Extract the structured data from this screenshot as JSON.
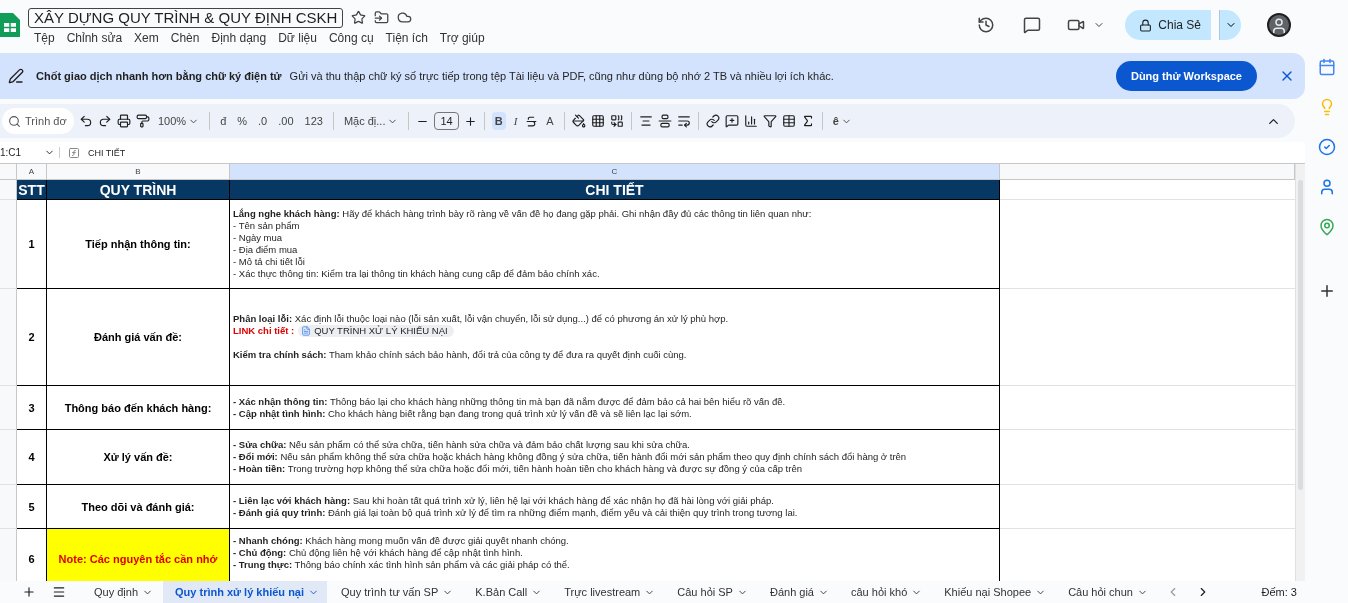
{
  "document": {
    "title": "XÂY DỰNG QUY TRÌNH & QUY ĐỊNH CSKH"
  },
  "menu": [
    "Tệp",
    "Chỉnh sửa",
    "Xem",
    "Chèn",
    "Định dạng",
    "Dữ liệu",
    "Công cụ",
    "Tiện ích",
    "Trợ giúp"
  ],
  "share_button": "Chia Sẻ",
  "banner": {
    "headline": "Chốt giao dịch nhanh hơn bằng chữ ký điện tử",
    "text": "Gửi và thu thập chữ ký số trực tiếp trong tệp Tài liệu và PDF, cũng như dùng bộ nhớ 2 TB và nhiều lợi ích khác.",
    "button": "Dùng thử Workspace"
  },
  "toolbar": {
    "search_placeholder": "Trình đơ",
    "zoom": "100%",
    "currency": "đ",
    "percent": "%",
    "decimal_decrease": ".0",
    "decimal_increase": ".00",
    "number_format": "123",
    "font": "Mặc đị...",
    "font_size": "14",
    "bold": {
      "label": "B",
      "selected": true
    },
    "italic": {
      "label": "I",
      "selected": false
    },
    "text_color": "A",
    "input_tools": "ê"
  },
  "formula_bar": {
    "name_box": "1:C1",
    "formula": "CHI TIẾT"
  },
  "columns": [
    "A",
    "B",
    "C"
  ],
  "header_row": [
    "STT",
    "QUY TRÌNH",
    "CHI TIẾT"
  ],
  "rows": [
    {
      "stt": "1",
      "step": "Tiếp nhận thông tin:",
      "highlight": false,
      "details": [
        {
          "kind": "text",
          "text": "**Lắng nghe khách hàng:** Hãy để khách hàng trình bày rõ ràng về vấn đề họ đang gặp phải. Ghi nhận đầy đủ các thông tin liên quan như:"
        },
        {
          "kind": "text",
          "text": "- Tên sản phẩm"
        },
        {
          "kind": "text",
          "text": "- Ngày mua"
        },
        {
          "kind": "text",
          "text": "- Địa điểm mua"
        },
        {
          "kind": "text",
          "text": "- Mô tả chi tiết lỗi"
        },
        {
          "kind": "text",
          "text": "- Xác thực thông tin: Kiểm tra lại thông tin khách hàng cung cấp để đảm bảo chính xác."
        }
      ]
    },
    {
      "stt": "2",
      "step": "Đánh giá vấn đề:",
      "highlight": false,
      "details": [
        {
          "kind": "text",
          "text": "**Phân loại lỗi:** Xác định lỗi thuộc loại nào (lỗi sản xuất, lỗi vận chuyển, lỗi sử dụng...) để có phương án xử lý phù hợp."
        },
        {
          "kind": "link",
          "text": "LINK chi tiết :",
          "chip": "QUY TRÌNH XỬ LÝ KHIẾU NẠI"
        },
        {
          "kind": "spaced",
          "text": "**Kiểm tra chính sách:** Tham khảo chính sách bảo hành, đổi trả của công ty để đưa ra quyết định cuối cùng."
        }
      ]
    },
    {
      "stt": "3",
      "step": "Thông báo đến khách hàng:",
      "highlight": false,
      "details": [
        {
          "kind": "text",
          "text": "**- Xác nhận thông tin:** Thông báo lại cho khách hàng những thông tin mà bạn đã nắm được để đảm bảo cả hai bên hiểu rõ vấn đề."
        },
        {
          "kind": "text",
          "text": "**- Cập nhật tình hình:** Cho khách hàng biết rằng bạn đang trong quá trình xử lý vấn đề và sẽ liên lạc lại sớm."
        }
      ]
    },
    {
      "stt": "4",
      "step": "Xử lý vấn đề:",
      "highlight": false,
      "details": [
        {
          "kind": "text",
          "text": "**- Sửa chữa:** Nếu sản phẩm có thể sửa chữa, tiến hành sửa chữa và đảm bảo chất lượng sau khi sửa chữa."
        },
        {
          "kind": "text",
          "text": "**- Đổi mới:** Nếu sản phẩm không thể sửa chữa hoặc khách hàng không đồng ý sửa chữa, tiến hành đổi mới sản phẩm theo quy định chính sách đổi hàng ở trên"
        },
        {
          "kind": "text",
          "text": "**- Hoàn tiền:** Trong trường hợp không thể sửa chữa hoặc đổi mới, tiến hành hoàn tiền cho khách hàng và được sự đồng ý của cấp trên"
        }
      ]
    },
    {
      "stt": "5",
      "step": "Theo dõi và đánh giá:",
      "highlight": false,
      "details": [
        {
          "kind": "text",
          "text": "**- Liên lạc với khách hàng:** Sau khi hoàn tất quá trình xử lý, liên hệ lại với khách hàng để xác nhận họ đã hài lòng với giải pháp."
        },
        {
          "kind": "text",
          "text": "**- Đánh giá quy trình:** Đánh giá lại toàn bộ quá trình xử lý để tìm ra những điểm mạnh, điểm yếu và cải thiện quy trình trong tương lai."
        }
      ]
    },
    {
      "stt": "6",
      "step": "Note: Các nguyên tắc cần nhớ",
      "highlight": true,
      "details": [
        {
          "kind": "text",
          "text": "**- Nhanh chóng:** Khách hàng mong muốn vấn đề được giải quyết nhanh chóng."
        },
        {
          "kind": "text",
          "text": "**- Chủ động:** Chủ động liên hệ với khách hàng để cập nhật tình hình."
        },
        {
          "kind": "text",
          "text": "**- Trung thực:** Thông báo chính xác tình hình sản phẩm và các giải pháp có thể."
        }
      ]
    }
  ],
  "sheet_tabs": [
    {
      "label": "Quy định",
      "selected": false
    },
    {
      "label": "Quy trình xử lý khiếu nại",
      "selected": true
    },
    {
      "label": "Quy trình tư vấn SP",
      "selected": false
    },
    {
      "label": "K.Bản Call",
      "selected": false
    },
    {
      "label": "Trực livestream",
      "selected": false
    },
    {
      "label": "Câu hỏi SP",
      "selected": false
    },
    {
      "label": "Đánh giá",
      "selected": false
    },
    {
      "label": "câu hỏi khó",
      "selected": false
    },
    {
      "label": "Khiếu nại Shopee",
      "selected": false
    },
    {
      "label": "Câu hỏi chun",
      "selected": false
    }
  ],
  "status": "Đếm: 3"
}
